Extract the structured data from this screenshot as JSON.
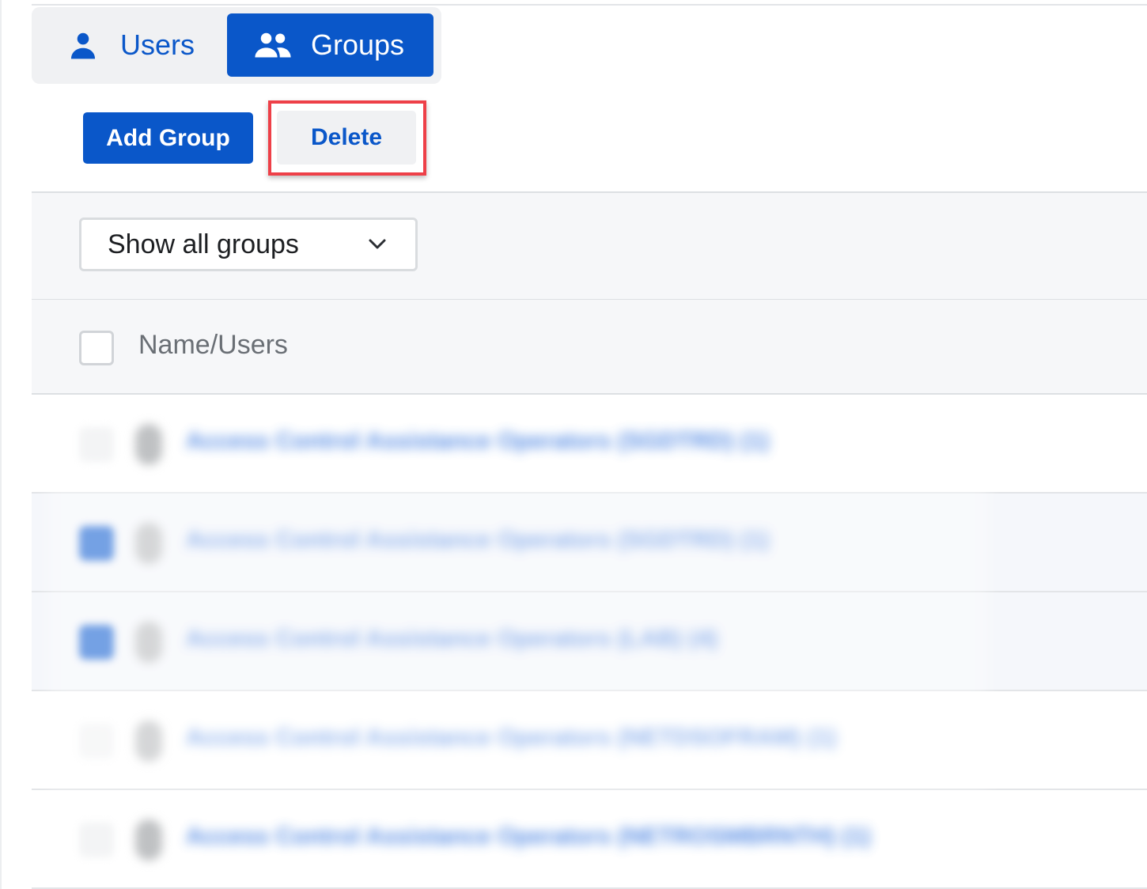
{
  "tabs": {
    "users": {
      "label": "Users",
      "icon": "user-icon"
    },
    "groups": {
      "label": "Groups",
      "icon": "users-group-icon",
      "active": true
    }
  },
  "toolbar": {
    "add_group_label": "Add Group",
    "delete_label": "Delete"
  },
  "filter": {
    "selected": "Show all groups",
    "icon": "chevron-down-icon"
  },
  "table": {
    "header": {
      "name_users": "Name/Users"
    },
    "rows": [
      {
        "name": "Access Control Assistance Operators (SGDTRD) (1)",
        "selected": false
      },
      {
        "name": "Access Control Assistance Operators (SGDTRD) (1)",
        "selected": true
      },
      {
        "name": "Access Control Assistance Operators (LAB) (4)",
        "selected": true
      },
      {
        "name": "Access Control Assistance Operators (NETDSOFRAM) (1)",
        "selected": false
      },
      {
        "name": "Access Control Assistance Operators (NETROSMBRNTH) (1)",
        "selected": false
      }
    ]
  },
  "colors": {
    "primary": "#0a57c9",
    "highlight": "#ee4048"
  }
}
